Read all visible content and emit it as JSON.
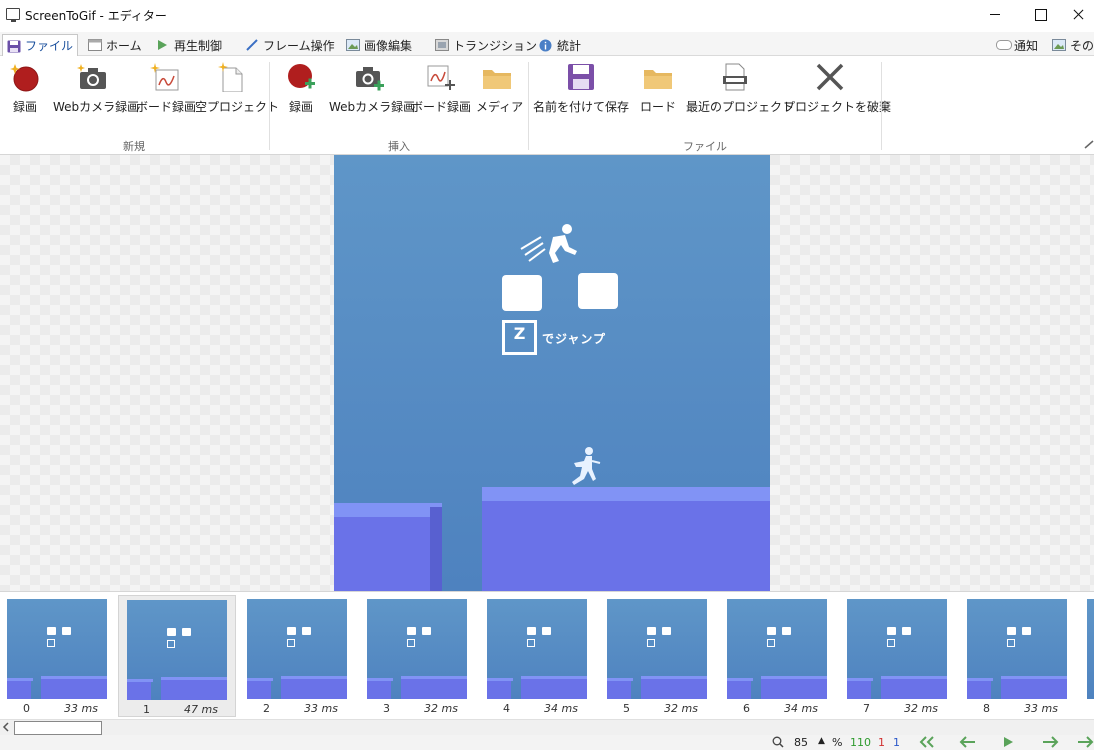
{
  "window": {
    "title": "ScreenToGif - エディター"
  },
  "tabs": [
    {
      "label": "ファイル",
      "icon": "save-icon"
    },
    {
      "label": "ホーム",
      "icon": "home-icon"
    },
    {
      "label": "再生制御",
      "icon": "play-icon"
    },
    {
      "label": "フレーム操作",
      "icon": "pencil-icon"
    },
    {
      "label": "画像編集",
      "icon": "image-icon"
    },
    {
      "label": "トランジション",
      "icon": "transition-icon"
    },
    {
      "label": "統計",
      "icon": "info-icon"
    }
  ],
  "right_tabs": [
    {
      "label": "通知",
      "icon": "notification-icon"
    },
    {
      "label": "その",
      "icon": "other-icon"
    }
  ],
  "ribbon": {
    "groups": [
      {
        "label": "新規",
        "buttons": [
          "録画",
          "Webカメラ録画",
          "ボード録画",
          "空プロジェクト"
        ]
      },
      {
        "label": "挿入",
        "buttons": [
          "録画",
          "Webカメラ録画",
          "ボード録画",
          "メディア"
        ]
      },
      {
        "label": "ファイル",
        "buttons": [
          "名前を付けて保存",
          "ロード",
          "最近のプロジェクト",
          "プロジェクトを破棄"
        ]
      }
    ]
  },
  "frame_preview": {
    "overlay_key": "Z",
    "overlay_text": "でジャンプ"
  },
  "frames": [
    {
      "index": "0",
      "delay": "33 ms"
    },
    {
      "index": "1",
      "delay": "47 ms"
    },
    {
      "index": "2",
      "delay": "33 ms"
    },
    {
      "index": "3",
      "delay": "32 ms"
    },
    {
      "index": "4",
      "delay": "34 ms"
    },
    {
      "index": "5",
      "delay": "32 ms"
    },
    {
      "index": "6",
      "delay": "34 ms"
    },
    {
      "index": "7",
      "delay": "32 ms"
    },
    {
      "index": "8",
      "delay": "33 ms"
    }
  ],
  "selected_frame": 1,
  "status": {
    "zoom": "85",
    "zoom_unit": "%",
    "frame_count": "110",
    "selected_count": "1",
    "current": "1"
  },
  "colors": {
    "accent": "#1a4f9c",
    "frame_bg": "#5f96c8",
    "platform": "#6a72e8",
    "count_green": "#2e9b2e",
    "count_red": "#d03030",
    "count_blue": "#2a57c9"
  }
}
